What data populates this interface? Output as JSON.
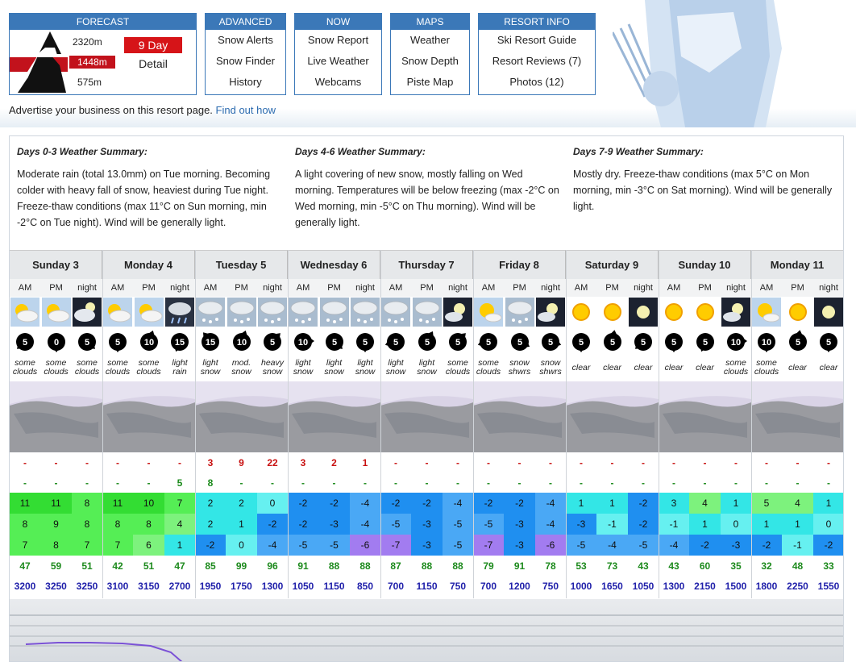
{
  "nav": {
    "forecast": {
      "header": "FORECAST",
      "elev_top": "2320m",
      "elev_mid": "1448m",
      "elev_bot": "575m",
      "nine_day": "9 Day",
      "detail": "Detail"
    },
    "advanced": {
      "header": "ADVANCED",
      "items": [
        "Snow Alerts",
        "Snow Finder",
        "History"
      ]
    },
    "now": {
      "header": "NOW",
      "items": [
        "Snow Report",
        "Live Weather",
        "Webcams"
      ]
    },
    "maps": {
      "header": "MAPS",
      "items": [
        "Weather",
        "Snow Depth",
        "Piste Map"
      ]
    },
    "resort": {
      "header": "RESORT INFO",
      "items": [
        "Ski Resort Guide",
        "Resort Reviews (7)",
        "Photos (12)"
      ]
    }
  },
  "advert": {
    "text": "Advertise your business on this resort page.",
    "link": "Find out how"
  },
  "summaries": [
    {
      "title": "Days 0-3 Weather Summary:",
      "body": "Moderate rain (total 13.0mm) on Tue morning. Becoming colder with heavy fall of snow, heaviest during Tue night. Freeze-thaw conditions (max 11°C on Sun morning, min -2°C on Tue night). Wind will be generally light."
    },
    {
      "title": "Days 4-6 Weather Summary:",
      "body": "A light covering of new snow, mostly falling on Wed morning. Temperatures will be below freezing (max -2°C on Wed morning, min -5°C on Thu morning). Wind will be generally light."
    },
    {
      "title": "Days 7-9 Weather Summary:",
      "body": "Mostly dry. Freeze-thaw conditions (max 5°C on Mon morning, min -3°C on Sat morning). Wind will be generally light."
    }
  ],
  "days": [
    "Sunday 3",
    "Monday 4",
    "Tuesday 5",
    "Wednesday 6",
    "Thursday 7",
    "Friday 8",
    "Saturday 9",
    "Sunday 10",
    "Monday 11"
  ],
  "tod": [
    "AM",
    "PM",
    "night"
  ],
  "icons": [
    "partly-cloudy-day",
    "partly-cloudy-day",
    "cloudy-night",
    "partly-cloudy-day",
    "partly-cloudy-day",
    "rain-cloud",
    "snow-cloud",
    "snow-cloud",
    "snow-cloud",
    "snow-cloud",
    "snow-cloud",
    "snow-cloud",
    "snow-cloud",
    "snow-cloud",
    "cloudy-moon",
    "sun-cloud",
    "snow-cloud",
    "cloudy-moon",
    "sun",
    "sun",
    "moon",
    "sun",
    "sun",
    "cloudy-moon",
    "sun-cloud",
    "sun",
    "moon"
  ],
  "wind": [
    "5",
    "0",
    "5",
    "5",
    "10",
    "15",
    "15",
    "10",
    "5",
    "10",
    "5",
    "5",
    "5",
    "5",
    "5",
    "5",
    "5",
    "5",
    "5",
    "5",
    "5",
    "5",
    "5",
    "10",
    "10",
    "5",
    "5"
  ],
  "wind_dir_deg": [
    225,
    180,
    135,
    180,
    20,
    200,
    320,
    20,
    45,
    90,
    135,
    180,
    250,
    30,
    45,
    250,
    120,
    110,
    180,
    10,
    225,
    180,
    200,
    90,
    180,
    10,
    180
  ],
  "weather_desc": [
    "some clouds",
    "some clouds",
    "some clouds",
    "some clouds",
    "some clouds",
    "light rain",
    "light snow",
    "mod. snow",
    "heavy snow",
    "light snow",
    "light snow",
    "light snow",
    "light snow",
    "light snow",
    "some clouds",
    "some clouds",
    "snow shwrs",
    "snow shwrs",
    "clear",
    "clear",
    "clear",
    "clear",
    "clear",
    "some clouds",
    "some clouds",
    "clear",
    "clear"
  ],
  "snow": [
    "-",
    "-",
    "-",
    "-",
    "-",
    "-",
    "3",
    "9",
    "22",
    "3",
    "2",
    "1",
    "-",
    "-",
    "-",
    "-",
    "-",
    "-",
    "-",
    "-",
    "-",
    "-",
    "-",
    "-",
    "-",
    "-",
    "-"
  ],
  "rain": [
    "-",
    "-",
    "-",
    "-",
    "-",
    "5",
    "8",
    "-",
    "-",
    "-",
    "-",
    "-",
    "-",
    "-",
    "-",
    "-",
    "-",
    "-",
    "-",
    "-",
    "-",
    "-",
    "-",
    "-",
    "-",
    "-",
    "-"
  ],
  "temp_max": [
    "11",
    "11",
    "8",
    "11",
    "10",
    "7",
    "2",
    "2",
    "0",
    "-2",
    "-2",
    "-4",
    "-2",
    "-2",
    "-4",
    "-2",
    "-2",
    "-4",
    "1",
    "1",
    "-2",
    "3",
    "4",
    "1",
    "5",
    "4",
    "1"
  ],
  "temp_min": [
    "8",
    "9",
    "8",
    "8",
    "8",
    "4",
    "2",
    "1",
    "-2",
    "-2",
    "-3",
    "-4",
    "-5",
    "-3",
    "-5",
    "-5",
    "-3",
    "-4",
    "-3",
    "-1",
    "-2",
    "-1",
    "1",
    "0",
    "1",
    "1",
    "0"
  ],
  "temp_chill": [
    "7",
    "8",
    "7",
    "7",
    "6",
    "1",
    "-2",
    "0",
    "-4",
    "-5",
    "-5",
    "-6",
    "-7",
    "-3",
    "-5",
    "-7",
    "-3",
    "-6",
    "-5",
    "-4",
    "-5",
    "-4",
    "-2",
    "-3",
    "-2",
    "-1",
    "-2"
  ],
  "humidity": [
    "47",
    "59",
    "51",
    "42",
    "51",
    "47",
    "85",
    "99",
    "96",
    "91",
    "88",
    "88",
    "87",
    "88",
    "88",
    "79",
    "91",
    "78",
    "53",
    "73",
    "43",
    "43",
    "60",
    "35",
    "32",
    "48",
    "33"
  ],
  "freezing": [
    "3200",
    "3250",
    "3250",
    "3100",
    "3150",
    "2700",
    "1950",
    "1750",
    "1300",
    "1050",
    "1150",
    "850",
    "700",
    "1150",
    "750",
    "700",
    "1200",
    "750",
    "1000",
    "1650",
    "1050",
    "1300",
    "2150",
    "1500",
    "1800",
    "2250",
    "1550"
  ],
  "colors": {
    "nav_blue": "#3b78b8",
    "nine_day_red": "#d61418",
    "snow_red": "#c81010",
    "rain_green": "#1a8a1a",
    "freeze_blue": "#2020aa"
  }
}
